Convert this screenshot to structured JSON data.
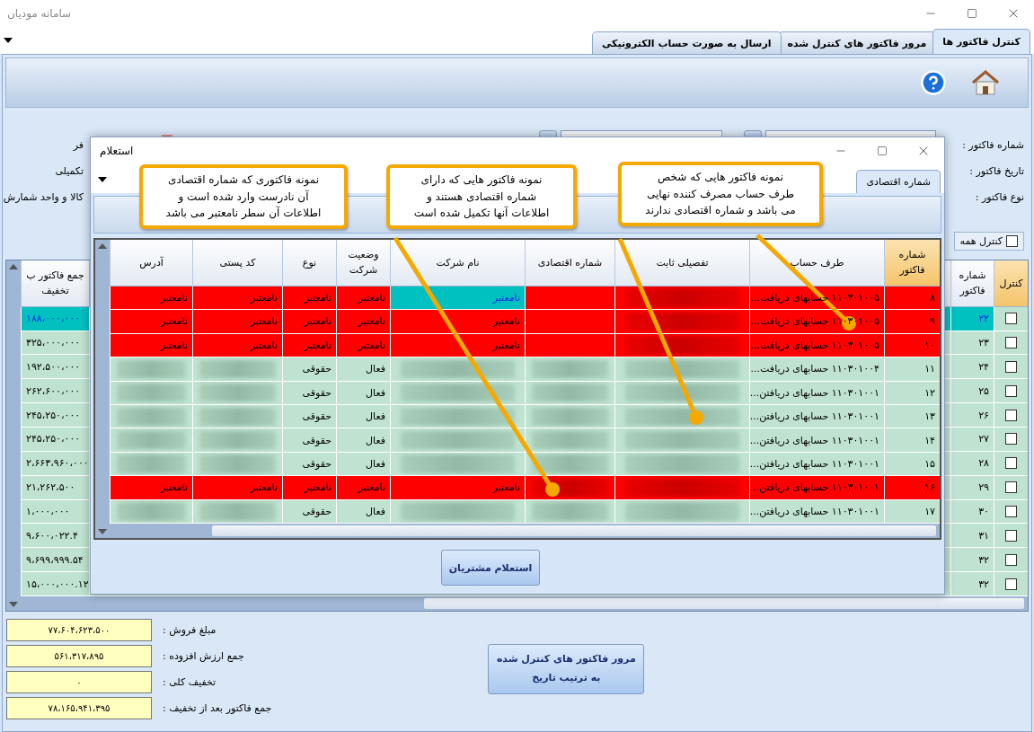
{
  "window": {
    "title": "سامانه مودیان"
  },
  "tabs": [
    {
      "label": "کنترل فاکتور ها",
      "selected": true
    },
    {
      "label": "مرور فاکتور های کنترل شده",
      "selected": false
    },
    {
      "label": "ارسال به صورت حساب الکترونیکی",
      "selected": false
    }
  ],
  "form": {
    "right_labels": [
      "شماره فاکتور :",
      "تاریخ فاکتور :",
      "نوع فاکتور :"
    ],
    "left_labels": [
      "فر",
      "تکمیلی",
      "کالا و واحد شمارش"
    ],
    "check_all": {
      "label": "کنترل همه",
      "checked": false
    }
  },
  "grid": {
    "columns": [
      "کنترل",
      "شماره فاکتور",
      "جمع فاکتور ب تخفیف"
    ],
    "rows": [
      {
        "number": "۲۲",
        "total": "۱۸۸،۰۰۰،۰۰۰",
        "selected": true,
        "checked": false
      },
      {
        "number": "۲۳",
        "total": "۳۲۵،۰۰۰،۰۰۰",
        "selected": false,
        "checked": false
      },
      {
        "number": "۲۴",
        "total": "۱۹۲،۵۰۰،۰۰۰",
        "selected": false,
        "checked": false
      },
      {
        "number": "۲۵",
        "total": "۲۶۲،۶۰۰،۰۰۰",
        "selected": false,
        "checked": false
      },
      {
        "number": "۲۶",
        "total": "۲۴۵،۲۵۰،۰۰۰",
        "selected": false,
        "checked": false
      },
      {
        "number": "۲۷",
        "total": "۲۴۵،۲۵۰،۰۰۰",
        "selected": false,
        "checked": false
      },
      {
        "number": "۲۸",
        "total": "۲،۶۶۳،۹۶۰،۰۰۰",
        "selected": false,
        "checked": false
      },
      {
        "number": "۲۹",
        "total": "۲۱،۲۶۲،۵۰۰",
        "selected": false,
        "checked": false
      },
      {
        "number": "۳۰",
        "total": "۱،۰۰۰،۰۰۰",
        "selected": false,
        "checked": false
      },
      {
        "number": "۳۱",
        "total": "۹،۶۰۰،۰۲۲.۴",
        "selected": false,
        "checked": false
      },
      {
        "number": "۳۲",
        "total": "۹،۶۹۹،۹۹۹.۵۴",
        "selected": false,
        "checked": false
      },
      {
        "number": "۳۲",
        "total": "۱۵،۰۰۰،۰۰۰.۱۲",
        "selected": false,
        "checked": false
      }
    ]
  },
  "dialog": {
    "title": "استعلام",
    "tab": "شماره اقتصادی",
    "table": {
      "columns": [
        "شماره فاکتور",
        "طرف حساب",
        "تفصیلی ثابت",
        "شماره اقتصادی",
        "نام شرکت",
        "وضعیت شرکت",
        "نوع",
        "کد پستی",
        "آدرس"
      ],
      "rows": [
        {
          "invalid": true,
          "cells": [
            {
              "kind": "text",
              "text": "۸"
            },
            {
              "kind": "text",
              "text": "۱۱۰۳۰۱۰۰۵  حسابهای دریافت..."
            },
            {
              "kind": "blurred"
            },
            {
              "kind": "empty"
            },
            {
              "kind": "current",
              "text": "نامعتبر"
            },
            {
              "kind": "text",
              "text": "نامعتبر"
            },
            {
              "kind": "text",
              "text": "نامعتبر"
            },
            {
              "kind": "text",
              "text": "نامعتبر"
            },
            {
              "kind": "text",
              "text": "نامعتبر"
            }
          ]
        },
        {
          "invalid": true,
          "cells": [
            {
              "kind": "text",
              "text": "۹"
            },
            {
              "kind": "text",
              "text": "۱۱۰۳۰۱۰۰۵  حسابهای دریافت..."
            },
            {
              "kind": "blurred"
            },
            {
              "kind": "empty"
            },
            {
              "kind": "text",
              "text": "نامعتبر"
            },
            {
              "kind": "text",
              "text": "نامعتبر"
            },
            {
              "kind": "text",
              "text": "نامعتبر"
            },
            {
              "kind": "text",
              "text": "نامعتبر"
            },
            {
              "kind": "text",
              "text": "نامعتبر"
            }
          ]
        },
        {
          "invalid": true,
          "cells": [
            {
              "kind": "text",
              "text": "۱۰"
            },
            {
              "kind": "text",
              "text": "۱۱۰۳۰۱۰۰۵  حسابهای دریافت..."
            },
            {
              "kind": "blurred"
            },
            {
              "kind": "empty"
            },
            {
              "kind": "text",
              "text": "نامعتبر"
            },
            {
              "kind": "text",
              "text": "نامعتبر"
            },
            {
              "kind": "text",
              "text": "نامعتبر"
            },
            {
              "kind": "text",
              "text": "نامعتبر"
            },
            {
              "kind": "text",
              "text": "نامعتبر"
            }
          ]
        },
        {
          "invalid": false,
          "cells": [
            {
              "kind": "text",
              "text": "۱۱"
            },
            {
              "kind": "text",
              "text": "۱۱۰۳۰۱۰۰۴  حسابهای دریافت..."
            },
            {
              "kind": "blurred"
            },
            {
              "kind": "blurred"
            },
            {
              "kind": "blurred"
            },
            {
              "kind": "text",
              "text": "فعال"
            },
            {
              "kind": "text",
              "text": "حقوقی"
            },
            {
              "kind": "blurred"
            },
            {
              "kind": "blurred"
            }
          ]
        },
        {
          "invalid": false,
          "cells": [
            {
              "kind": "text",
              "text": "۱۲"
            },
            {
              "kind": "text",
              "text": "۱۱۰۳۰۱۰۰۱  حسابهای دریافتن..."
            },
            {
              "kind": "blurred"
            },
            {
              "kind": "blurred"
            },
            {
              "kind": "blurred"
            },
            {
              "kind": "text",
              "text": "فعال"
            },
            {
              "kind": "text",
              "text": "حقوقی"
            },
            {
              "kind": "blurred"
            },
            {
              "kind": "blurred"
            }
          ]
        },
        {
          "invalid": false,
          "cells": [
            {
              "kind": "text",
              "text": "۱۳"
            },
            {
              "kind": "text",
              "text": "۱۱۰۳۰۱۰۰۱  حسابهای دریافتن..."
            },
            {
              "kind": "blurred"
            },
            {
              "kind": "blurred"
            },
            {
              "kind": "blurred"
            },
            {
              "kind": "text",
              "text": "فعال"
            },
            {
              "kind": "text",
              "text": "حقوقی"
            },
            {
              "kind": "blurred"
            },
            {
              "kind": "blurred"
            }
          ]
        },
        {
          "invalid": false,
          "cells": [
            {
              "kind": "text",
              "text": "۱۴"
            },
            {
              "kind": "text",
              "text": "۱۱۰۳۰۱۰۰۱  حسابهای دریافتن..."
            },
            {
              "kind": "blurred"
            },
            {
              "kind": "blurred"
            },
            {
              "kind": "blurred"
            },
            {
              "kind": "text",
              "text": "فعال"
            },
            {
              "kind": "text",
              "text": "حقوقی"
            },
            {
              "kind": "blurred"
            },
            {
              "kind": "blurred"
            }
          ]
        },
        {
          "invalid": false,
          "cells": [
            {
              "kind": "text",
              "text": "۱۵"
            },
            {
              "kind": "text",
              "text": "۱۱۰۳۰۱۰۰۱  حسابهای دریافتن..."
            },
            {
              "kind": "blurred"
            },
            {
              "kind": "blurred"
            },
            {
              "kind": "blurred"
            },
            {
              "kind": "text",
              "text": "فعال"
            },
            {
              "kind": "text",
              "text": "حقوقی"
            },
            {
              "kind": "blurred"
            },
            {
              "kind": "blurred"
            }
          ]
        },
        {
          "invalid": true,
          "cells": [
            {
              "kind": "text",
              "text": "۱۶"
            },
            {
              "kind": "text",
              "text": "۱۱۰۳۰۱۰۰۱  حسابهای دریافتن..."
            },
            {
              "kind": "blurred"
            },
            {
              "kind": "blurred"
            },
            {
              "kind": "text",
              "text": "نامعتبر"
            },
            {
              "kind": "text",
              "text": "نامعتبر"
            },
            {
              "kind": "text",
              "text": "نامعتبر"
            },
            {
              "kind": "text",
              "text": "نامعتبر"
            },
            {
              "kind": "text",
              "text": "نامعتبر"
            }
          ]
        },
        {
          "invalid": false,
          "cells": [
            {
              "kind": "text",
              "text": "۱۷"
            },
            {
              "kind": "text",
              "text": "۱۱۰۳۰۱۰۰۱  حسابهای دریافتن..."
            },
            {
              "kind": "blurred"
            },
            {
              "kind": "blurred"
            },
            {
              "kind": "blurred"
            },
            {
              "kind": "text",
              "text": "فعال"
            },
            {
              "kind": "text",
              "text": "حقوقی"
            },
            {
              "kind": "blurred"
            },
            {
              "kind": "blurred"
            }
          ]
        }
      ]
    },
    "button": "استعلام مشتریان"
  },
  "callouts": [
    {
      "text": "نمونه فاکتور هایی که شخص\nطرف حساب مصرف کننده نهایی\nمی باشد و شماره اقتصادی ندارند"
    },
    {
      "text": "نمونه فاکتور هایی که دارای\nشماره اقتصادی هستند و\nاطلاعات آنها تکمیل شده است"
    },
    {
      "text": "نمونه فاکتوری که شماره اقتصادی\nآن نادرست وارد شده است و\nاطلاعات آن سطر نامعتبر می باشد"
    }
  ],
  "summary": [
    {
      "label": "مبلغ فروش :",
      "value": "۷۷،۶۰۴،۶۲۳،۵۰۰"
    },
    {
      "label": "جمع ارزش افزوده :",
      "value": "۵۶۱،۳۱۷،۸۹۵"
    },
    {
      "label": "تخفیف کلی :",
      "value": "۰"
    },
    {
      "label": "جمع فاکتور بعد از تخفیف :",
      "value": "۷۸،۱۶۵،۹۴۱،۳۹۵"
    }
  ],
  "review_button": "مرور فاکتور های کنترل شده به ترتیب تاریخ"
}
